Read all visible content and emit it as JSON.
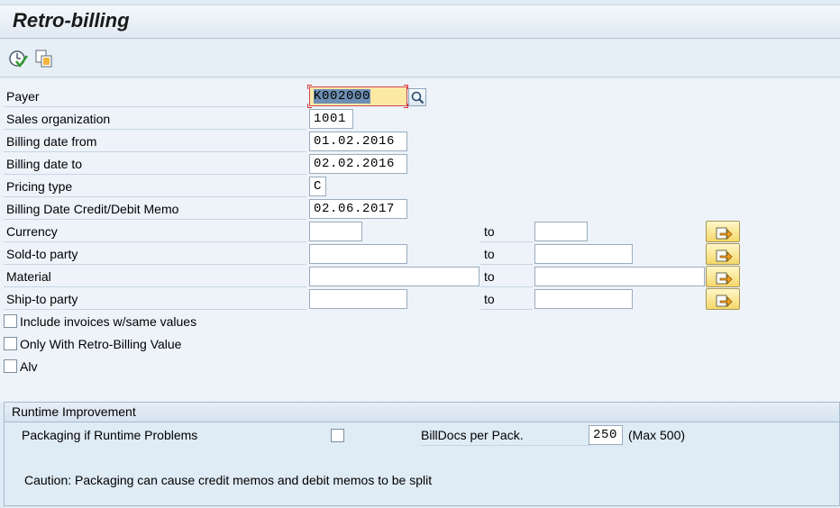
{
  "window": {
    "title": "Retro-billing"
  },
  "toolbar": {
    "execute_icon": "execute-icon",
    "copy_icon": "copy-variant-icon"
  },
  "fields": {
    "payer": {
      "label": "Payer",
      "value": "K002000"
    },
    "sales_org": {
      "label": "Sales organization",
      "value": "1001"
    },
    "billing_from": {
      "label": "Billing date from",
      "value": "01.02.2016"
    },
    "billing_to": {
      "label": "Billing date to",
      "value": "02.02.2016"
    },
    "pricing_type": {
      "label": "Pricing type",
      "value": "C"
    },
    "billing_credit_debit": {
      "label": "Billing Date Credit/Debit Memo",
      "value": "02.06.2017"
    }
  },
  "ranges": {
    "to_label": "to",
    "currency": {
      "label": "Currency",
      "from": "",
      "to": ""
    },
    "sold_to": {
      "label": "Sold-to party",
      "from": "",
      "to": ""
    },
    "material": {
      "label": "Material",
      "from": "",
      "to": ""
    },
    "ship_to": {
      "label": "Ship-to party",
      "from": "",
      "to": ""
    }
  },
  "checkboxes": {
    "include_invoices": {
      "label": "Include invoices w/same values",
      "checked": false
    },
    "only_retro": {
      "label": "Only With Retro-Billing Value",
      "checked": false
    },
    "alv": {
      "label": "Alv",
      "checked": false
    }
  },
  "runtime": {
    "title": "Runtime Improvement",
    "packaging_label": "Packaging if Runtime Problems",
    "billdocs_label": "BillDocs per Pack.",
    "billdocs_value": "250",
    "max_text": "(Max  500)",
    "caution": "Caution: Packaging can cause credit memos and debit memos to be split"
  }
}
